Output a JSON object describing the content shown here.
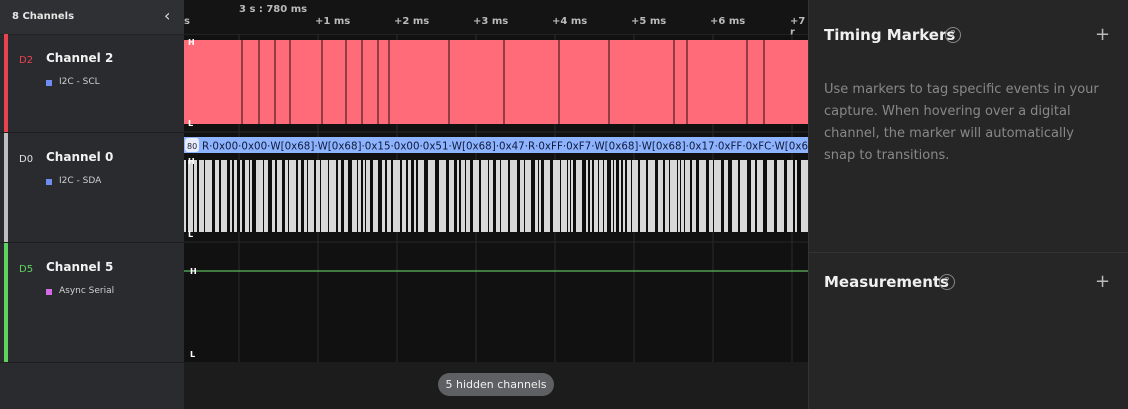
{
  "sidebar": {
    "title": "8 Channels",
    "collapse_icon": "chevron-left-icon",
    "channels": [
      {
        "tag": "D2",
        "name": "Channel 2",
        "analyzer": "I2C - SCL",
        "color": "#e9434f",
        "dot": "#6d8ef0"
      },
      {
        "tag": "D0",
        "name": "Channel 0",
        "analyzer": "I2C - SDA",
        "color": "#bfbfbf",
        "dot": "#6d8ef0"
      },
      {
        "tag": "D5",
        "name": "Channel 5",
        "analyzer": "Async Serial",
        "color": "#5ed25e",
        "dot": "#d36ae6"
      }
    ]
  },
  "ruler": {
    "cursor": "3 s : 780 ms",
    "left_fragment": "s",
    "ticks": [
      "+1 ms",
      "+2 ms",
      "+3 ms",
      "+4 ms",
      "+5 ms",
      "+6 ms",
      "+7 r"
    ]
  },
  "waveform": {
    "high_label": "H",
    "low_label": "L",
    "decode_text": "R·0x00·0x00·W[0x68]·W[0x68]·0x15·0x00·0x51·W[0x68]·0x47·R·0xFF·0xF7·W[0x68]·W[0x68]·0x17·0xFF·0xFC·W[0x6",
    "decode_badge": "80",
    "hidden_channels": "5 hidden channels"
  },
  "timing_markers": {
    "title": "Timing Markers",
    "description": "Use markers to tag specific events in your capture. When hovering over a digital channel, the marker will automatically snap to transitions.",
    "help_icon": "help-circle-icon",
    "add_icon": "plus-icon"
  },
  "measurements": {
    "title": "Measurements",
    "help_icon": "help-circle-icon",
    "add_icon": "plus-icon"
  }
}
